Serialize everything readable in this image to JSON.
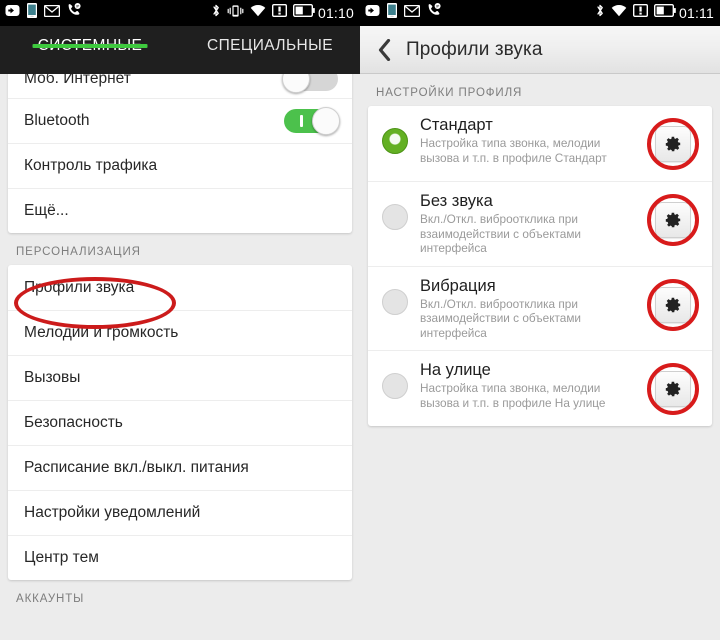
{
  "colors": {
    "accent_green": "#3ec93e",
    "toggle_on": "#4cc14c",
    "annotation_red": "#cc1b1b",
    "radio_selected": "#63b023",
    "statusbar_bg": "#000000",
    "tabbar_bg": "#1f1f1f",
    "page_bg": "#ececec",
    "card_bg": "#ffffff",
    "section_header_text": "#7d7d7d"
  },
  "left_screen": {
    "statusbar": {
      "time": "01:10",
      "left_icons": [
        "back-arrow-badge-icon",
        "phone-icon",
        "mail-icon",
        "missed-call-icon"
      ],
      "right_icons": [
        "bluetooth-icon",
        "vibrate-icon",
        "wifi-icon",
        "sim-alert-icon",
        "battery-icon"
      ]
    },
    "tabs": [
      {
        "label": "СИСТЕМНЫЕ",
        "active": true
      },
      {
        "label": "СПЕЦИАЛЬНЫЕ",
        "active": false
      }
    ],
    "groups": [
      {
        "header": "",
        "rows": [
          {
            "label": "Моб. Интернет",
            "control": "toggle",
            "state": "off"
          },
          {
            "label": "Bluetooth",
            "control": "toggle",
            "state": "on"
          },
          {
            "label": "Контроль трафика",
            "control": "none"
          },
          {
            "label": "Ещё...",
            "control": "none"
          }
        ]
      },
      {
        "header": "ПЕРСОНАЛИЗАЦИЯ",
        "rows": [
          {
            "label": "Профили звука",
            "control": "none",
            "annotated": true
          },
          {
            "label": "Мелодии и громкость",
            "control": "none"
          },
          {
            "label": "Вызовы",
            "control": "none"
          },
          {
            "label": "Безопасность",
            "control": "none"
          },
          {
            "label": "Расписание вкл./выкл. питания",
            "control": "none"
          },
          {
            "label": "Настройки уведомлений",
            "control": "none"
          },
          {
            "label": "Центр тем",
            "control": "none"
          }
        ]
      },
      {
        "header": "АККАУНТЫ",
        "rows": []
      }
    ]
  },
  "right_screen": {
    "statusbar": {
      "time": "01:11",
      "left_icons": [
        "back-arrow-badge-icon",
        "phone-icon",
        "mail-icon",
        "missed-call-icon"
      ],
      "right_icons": [
        "bluetooth-icon",
        "wifi-icon",
        "sim-alert-icon",
        "battery-icon"
      ]
    },
    "actionbar": {
      "back_label": "back-icon",
      "title": "Профили звука"
    },
    "section_header": "НАСТРОЙКИ ПРОФИЛЯ",
    "profiles": [
      {
        "title": "Стандарт",
        "desc": "Настройка типа звонка, мелодии вызова и т.п. в профиле Стандарт",
        "selected": true,
        "gear_annotated": true
      },
      {
        "title": "Без звука",
        "desc": "Вкл./Откл. виброотклика при взаимодействии с объектами интерфейса",
        "selected": false,
        "gear_annotated": true
      },
      {
        "title": "Вибрация",
        "desc": "Вкл./Откл. виброотклика при взаимодействии с объектами интерфейса",
        "selected": false,
        "gear_annotated": true
      },
      {
        "title": "На улице",
        "desc": "Настройка типа звонка, мелодии вызова и т.п. в профиле На улице",
        "selected": false,
        "gear_annotated": true
      }
    ]
  }
}
